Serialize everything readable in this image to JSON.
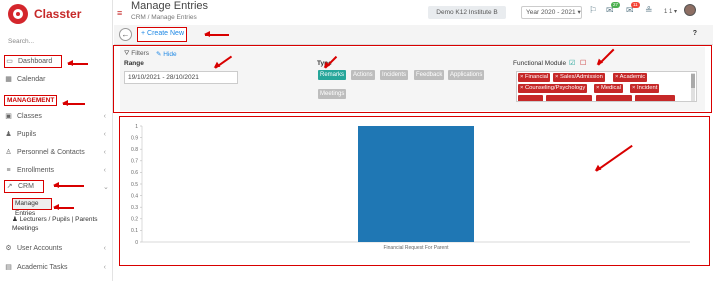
{
  "app": {
    "brand": "Classter"
  },
  "sidebar": {
    "search_placeholder": "Search...",
    "items": [
      {
        "label": "Dashboard",
        "icon": "laptop-icon"
      },
      {
        "label": "Calendar",
        "icon": "calendar-icon"
      },
      {
        "label": "MANAGEMENT"
      },
      {
        "label": "Classes",
        "icon": "classes-icon"
      },
      {
        "label": "Pupils",
        "icon": "users-icon"
      },
      {
        "label": "Personnel & Contacts",
        "icon": "contacts-icon"
      },
      {
        "label": "Enrollments",
        "icon": "enrollments-icon"
      },
      {
        "label": "CRM",
        "icon": "crm-icon"
      },
      {
        "label": "Manage Entries"
      },
      {
        "label": "Lecturers / Pupils | Parents Meetings"
      },
      {
        "label": "User Accounts",
        "icon": "accounts-icon"
      },
      {
        "label": "Academic Tasks",
        "icon": "tasks-icon"
      }
    ]
  },
  "header": {
    "title": "Manage Entries",
    "breadcrumb": [
      "CRM",
      "Manage Entries"
    ],
    "breadcrumb_sep": "/",
    "school": "Demo K12 Institute B",
    "year": "Year 2020 - 2021 ▾",
    "notif_badge_1": "27",
    "notif_badge_2": "11",
    "user_count": "1 1 ▾"
  },
  "toolbar": {
    "back_label": "←",
    "create_label": "Create New",
    "help_label": "?"
  },
  "filters": {
    "title": "Filters",
    "hide_label": "Hide",
    "range_label": "Range",
    "range_value": "19/10/2021 - 28/10/2021",
    "type_label": "Type",
    "types": [
      {
        "label": "Remarks",
        "active": true
      },
      {
        "label": "Actions",
        "active": false
      },
      {
        "label": "Incidents",
        "active": false
      },
      {
        "label": "Feedback",
        "active": false
      },
      {
        "label": "Applications",
        "active": false
      },
      {
        "label": "Meetings",
        "active": false
      }
    ],
    "fm_label": "Functional Module",
    "fm_tags": [
      "× Financial",
      "× Sales/Admission",
      "× Academic",
      "× Counseling/Psychology",
      "× Medical",
      "× Incident"
    ]
  },
  "chart_data": {
    "type": "bar",
    "categories": [
      "Financial Request For Parent"
    ],
    "values": [
      1
    ],
    "ylim": [
      0,
      1
    ],
    "yticks": [
      0,
      0.1,
      0.2,
      0.3,
      0.4,
      0.5,
      0.6,
      0.7,
      0.8,
      0.9,
      1
    ],
    "bar_color": "#1f77b4",
    "grid": false
  },
  "colors": {
    "brand_red": "#c62828",
    "accent_blue": "#1e88e5",
    "teal_active": "#26a69a",
    "annotation_red": "#d80000"
  }
}
